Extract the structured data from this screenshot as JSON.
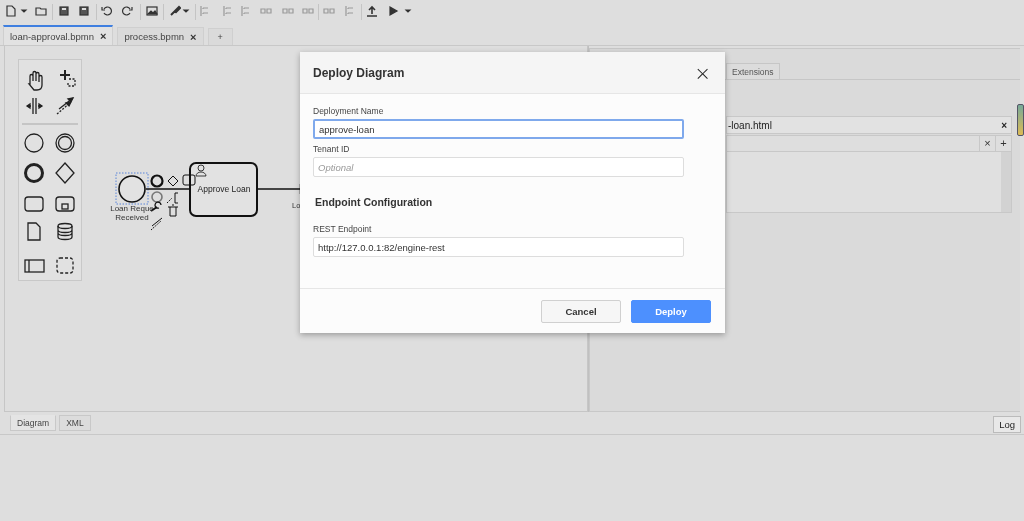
{
  "tabs": [
    {
      "label": "loan-approval.bpmn",
      "close": "×",
      "selected": true
    },
    {
      "label": "process.bpmn",
      "close": "×",
      "selected": false
    }
  ],
  "new_tab": "+",
  "diagram": {
    "start_label": [
      "Loan Reque",
      "Received"
    ],
    "task_label": "Approve Loan",
    "cut_label": "Lo"
  },
  "properties": {
    "tab": "Extensions",
    "field_value": "-loan.html",
    "field_clear": "×",
    "list_remove": "×",
    "list_add": "+"
  },
  "view_tabs": [
    {
      "label": "Diagram",
      "selected": true
    },
    {
      "label": "XML",
      "selected": false
    }
  ],
  "log_button": "Log",
  "dialog": {
    "title": "Deploy Diagram",
    "close": "×",
    "fields": [
      {
        "label": "Deployment Name",
        "value": "approve-loan",
        "focused": true
      },
      {
        "label": "Tenant ID",
        "placeholder": "Optional",
        "focused": false
      }
    ],
    "section": {
      "title": "Endpoint Configuration",
      "fields": [
        {
          "label": "REST Endpoint",
          "value": "http://127.0.0.1:82/engine-rest",
          "focused": false
        }
      ]
    },
    "buttons": [
      {
        "label": "Cancel",
        "kind": "secondary"
      },
      {
        "label": "Deploy",
        "kind": "primary"
      }
    ]
  }
}
